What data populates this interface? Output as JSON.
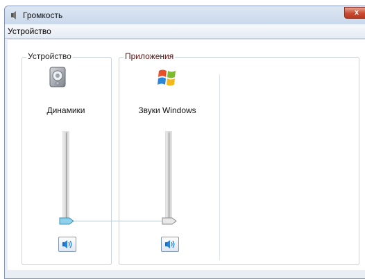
{
  "window": {
    "title": "Громкость",
    "close_glyph": "x"
  },
  "menu": {
    "device_label": "Устройство"
  },
  "device": {
    "group_label": "Устройство",
    "name": "Динамики",
    "icon": "speaker-device-icon",
    "volume_level": 0,
    "mute_icon": "speaker-volume-icon"
  },
  "apps": {
    "group_label": "Приложения",
    "items": [
      {
        "name": "Звуки Windows",
        "icon": "windows-logo-icon",
        "volume_level": 0,
        "mute_icon": "speaker-volume-icon"
      }
    ]
  },
  "colors": {
    "device_thumb": "#8fd0ea",
    "app_thumb": "#e8e8e8",
    "close_button": "#c94a32"
  }
}
